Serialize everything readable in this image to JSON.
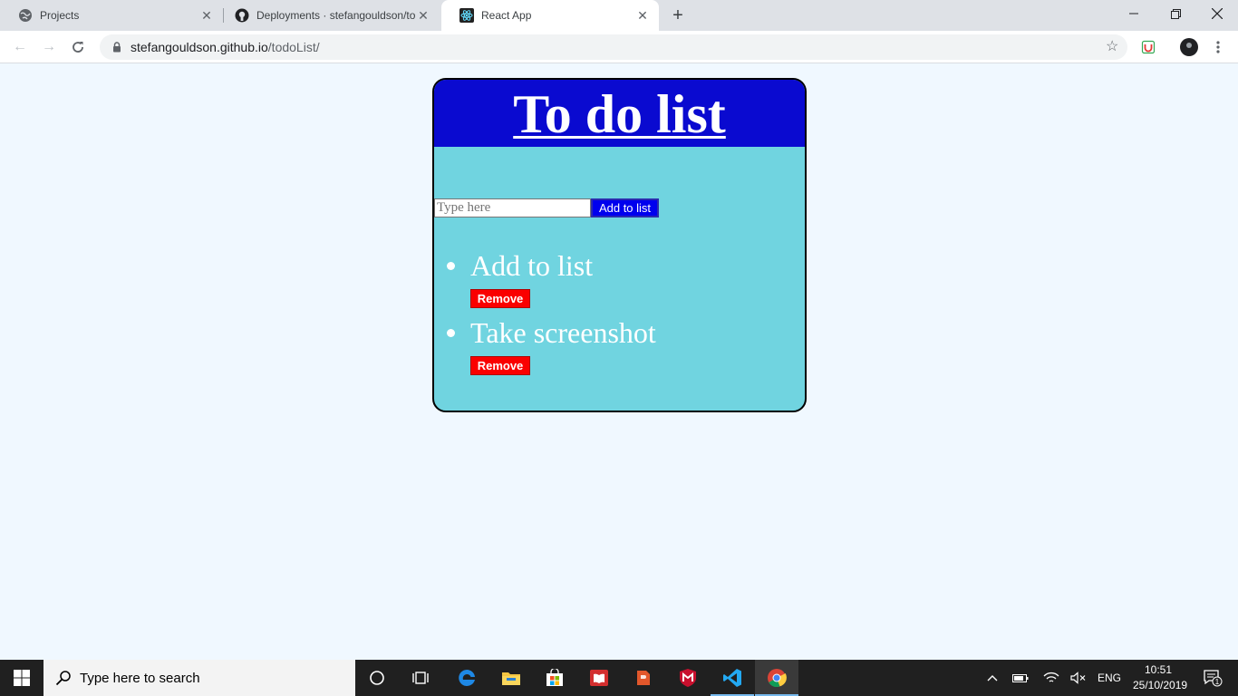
{
  "browser": {
    "tabs": [
      {
        "title": "Projects",
        "icon": "globe-icon"
      },
      {
        "title": "Deployments · stefangouldson/to",
        "icon": "github-icon"
      },
      {
        "title": "React App",
        "icon": "react-icon"
      }
    ],
    "url": {
      "host": "stefangouldson.github.io",
      "path": "/todoList/"
    }
  },
  "app": {
    "title": "To do list",
    "input_placeholder": "Type here",
    "add_button_label": "Add to list",
    "items": [
      {
        "text": "Add to list",
        "remove_label": "Remove"
      },
      {
        "text": "Take screenshot",
        "remove_label": "Remove"
      }
    ],
    "colors": {
      "header": "#0a0ad0",
      "card": "#70d4e0",
      "remove": "#fa0000",
      "add": "#0000ee"
    }
  },
  "taskbar": {
    "search_placeholder": "Type here to search",
    "language": "ENG",
    "time": "10:51",
    "date": "25/10/2019",
    "notification_count": "1"
  }
}
